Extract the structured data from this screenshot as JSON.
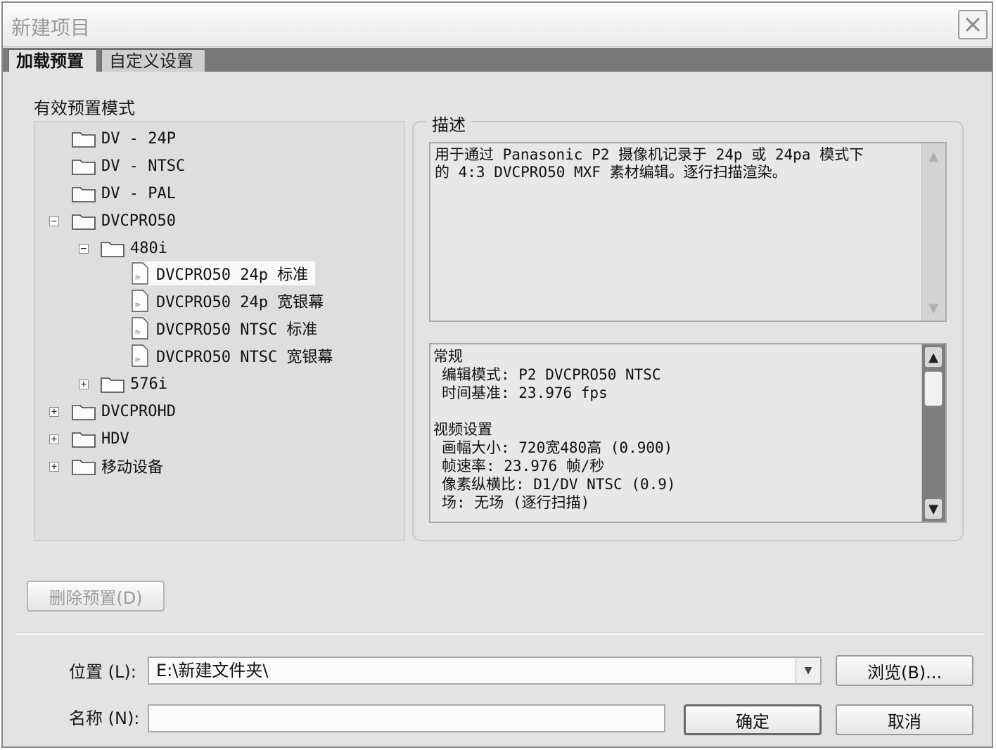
{
  "window": {
    "title": "新建项目"
  },
  "tabs": [
    {
      "label": "加载预置"
    },
    {
      "label": "自定义设置"
    }
  ],
  "presets": {
    "label": "有效预置模式",
    "tree": [
      "DV - 24P",
      "DV - NTSC",
      "DV - PAL",
      "DVCPRO50",
      "480i",
      "DVCPRO50 24p 标准",
      "DVCPRO50 24p 宽银幕",
      "DVCPRO50 NTSC 标准",
      "DVCPRO50 NTSC 宽银幕",
      "576i",
      "DVCPROHD",
      "HDV",
      "移动设备"
    ],
    "expanders": [
      "−",
      "−",
      "+",
      "+",
      "+",
      "+"
    ],
    "selected": "DVCPRO50 24p 标准"
  },
  "description": {
    "legend": "描述",
    "text_line1": "用于通过 Panasonic P2 摄像机记录于 24p 或 24pa 模式下",
    "text_line2": "的 4:3 DVCPRO50 MXF 素材编辑。逐行扫描渲染。"
  },
  "info": {
    "general_heading": "常规",
    "edit_mode": "编辑模式: P2 DVCPRO50 NTSC",
    "timebase": "时间基准: 23.976 fps",
    "video_heading": "视频设置",
    "frame_size": "画幅大小: 720宽480高 (0.900)",
    "frame_rate": "帧速率: 23.976 帧/秒",
    "pixel_aspect": "像素纵横比: D1/DV NTSC (0.9)",
    "fields": "场: 无场 (逐行扫描)"
  },
  "buttons": {
    "delete_preset": "删除预置(D)",
    "browse": "浏览(B)...",
    "ok": "确定",
    "cancel": "取消"
  },
  "location": {
    "label": "位置 (L):",
    "value": "E:\\新建文件夹\\"
  },
  "name": {
    "label": "名称 (N):",
    "value": ""
  },
  "icons": {
    "close": "close-icon",
    "folder": "folder-icon",
    "file": "premiere-file-icon",
    "dropdown": "chevron-down-icon"
  }
}
